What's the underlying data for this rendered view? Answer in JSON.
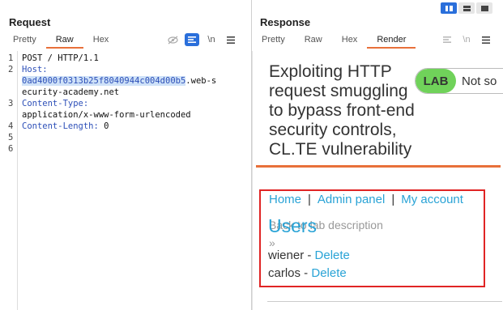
{
  "request": {
    "title": "Request",
    "tabs": [
      {
        "label": "Pretty",
        "active": false
      },
      {
        "label": "Raw",
        "active": true
      },
      {
        "label": "Hex",
        "active": false
      }
    ],
    "tools": {
      "newline_label": "\\n"
    },
    "line_numbers": [
      "1",
      "2",
      "3",
      "4",
      "5",
      "6"
    ],
    "lines": {
      "l1": "POST / HTTP/1.1",
      "l2_name": "Host:",
      "l2_val_hl": "0ad4000f0313b25f8040944c004d00b5",
      "l2_val_rest": ".web-s",
      "l2_val_cont": "ecurity-academy.net",
      "l3_name": "Content-Type:",
      "l3_val": "application/x-www-form-urlencoded",
      "l4_name": "Content-Length:",
      "l4_val": " 0"
    }
  },
  "response": {
    "title": "Response",
    "tabs": [
      {
        "label": "Pretty",
        "active": false
      },
      {
        "label": "Raw",
        "active": false
      },
      {
        "label": "Hex",
        "active": false
      },
      {
        "label": "Render",
        "active": true
      }
    ],
    "tools": {
      "newline_label": "\\n"
    },
    "render": {
      "lab_title": "Exploiting HTTP request smuggling to bypass front-end security controls, CL.TE vulnerability",
      "badge_lab": "LAB",
      "badge_status": "Not so",
      "back_link": "Back to lab description",
      "back_arrow": "»",
      "nav": {
        "home": "Home",
        "sep": "|",
        "admin": "Admin panel",
        "account": "My account"
      },
      "users_heading": "Users",
      "users": [
        {
          "name": "wiener",
          "dash": " - ",
          "action": "Delete"
        },
        {
          "name": "carlos",
          "dash": " - ",
          "action": "Delete"
        }
      ]
    }
  },
  "colors": {
    "accent": "#e8703a",
    "link": "#29a3d6",
    "highlight_box": "#e02424",
    "lab_badge": "#70d25a",
    "toggle_on": "#2a6fdb"
  }
}
